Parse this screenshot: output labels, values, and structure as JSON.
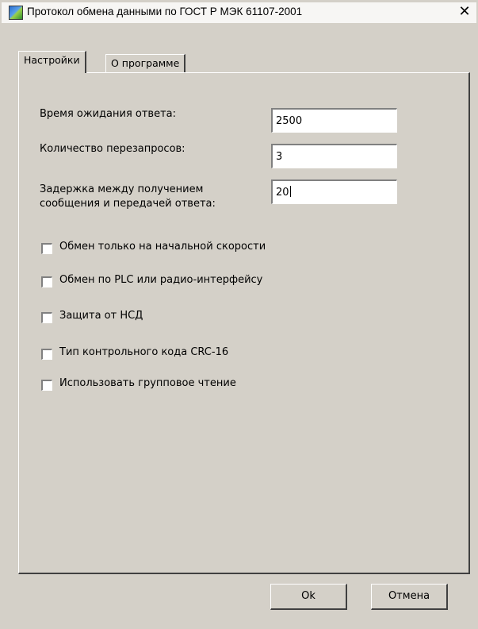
{
  "window": {
    "title": "Протокол обмена данными по ГОСТ Р МЭК 61107-2001",
    "close_glyph": "✕",
    "icon": "app-icon"
  },
  "tabs": [
    {
      "label": "Настройки",
      "active": true
    },
    {
      "label": "О программе",
      "active": false
    }
  ],
  "settings": {
    "timeout_label": "Время ожидания ответа:",
    "timeout_value": "2500",
    "retries_label": "Количество перезапросов:",
    "retries_value": "3",
    "delay_label_line1": "Задержка между получением",
    "delay_label_line2": "сообщения и передачей ответа:",
    "delay_value": "20"
  },
  "checkboxes": [
    {
      "label": "Обмен только на начальной скорости",
      "checked": false
    },
    {
      "label": "Обмен по PLC или радио-интерфейсу",
      "checked": false
    },
    {
      "label": "Защита от НСД",
      "checked": false
    },
    {
      "label": "Тип контрольного кода CRC-16",
      "checked": false
    },
    {
      "label": "Использовать групповое чтение",
      "checked": false
    }
  ],
  "buttons": {
    "ok": "Ok",
    "cancel": "Отмена"
  },
  "colors": {
    "dialog_bg": "#d4d0c8",
    "field_bg": "#ffffff"
  }
}
